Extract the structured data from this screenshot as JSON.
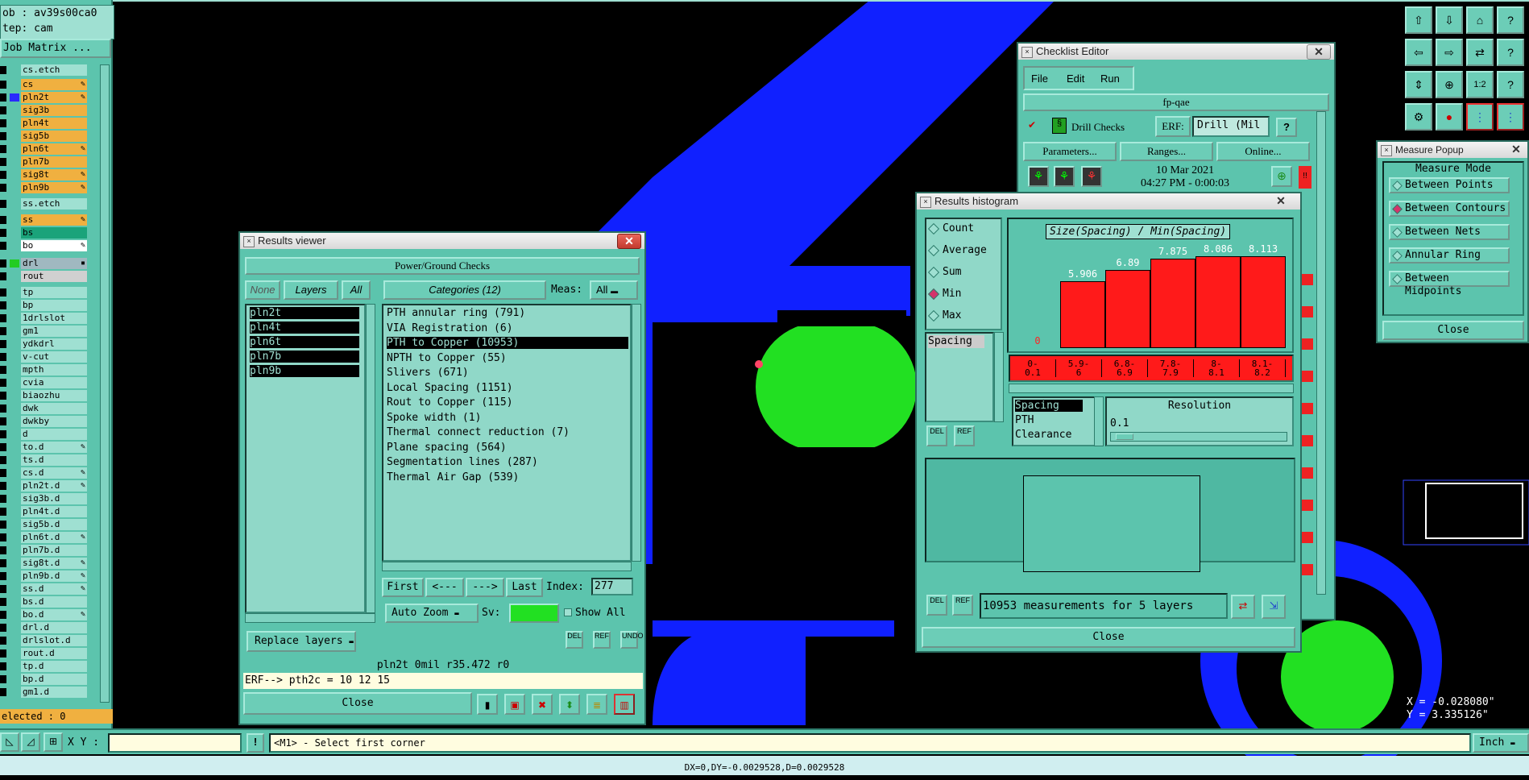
{
  "left_panel": {
    "job": "ob : av39s00ca0",
    "step": "tep: cam",
    "job_matrix_button": "Job Matrix ...",
    "layers": [
      {
        "name": "cs.etch",
        "color": "#9fe0d2",
        "swatch": "#5cc4ad",
        "mark": ""
      },
      {
        "name": "cs",
        "color": "#f0b040",
        "swatch": "#5cc4ad",
        "mark": "✎"
      },
      {
        "name": "pln2t",
        "color": "#f0b040",
        "swatch": "#2a2aff",
        "mark": "✎"
      },
      {
        "name": "sig3b",
        "color": "#f0b040",
        "swatch": "#5cc4ad",
        "mark": ""
      },
      {
        "name": "pln4t",
        "color": "#f0b040",
        "swatch": "#5cc4ad",
        "mark": ""
      },
      {
        "name": "sig5b",
        "color": "#f0b040",
        "swatch": "#5cc4ad",
        "mark": ""
      },
      {
        "name": "pln6t",
        "color": "#f0b040",
        "swatch": "#5cc4ad",
        "mark": "✎"
      },
      {
        "name": "pln7b",
        "color": "#f0b040",
        "swatch": "#5cc4ad",
        "mark": ""
      },
      {
        "name": "sig8t",
        "color": "#f0b040",
        "swatch": "#5cc4ad",
        "mark": "✎"
      },
      {
        "name": "pln9b",
        "color": "#f0b040",
        "swatch": "#5cc4ad",
        "mark": "✎"
      },
      {
        "name": "ss.etch",
        "color": "#9fe0d2",
        "swatch": "#5cc4ad",
        "mark": ""
      },
      {
        "name": "ss",
        "color": "#f0b040",
        "swatch": "#5cc4ad",
        "mark": "✎"
      },
      {
        "name": "bs",
        "color": "#1aa37a",
        "swatch": "#5cc4ad",
        "mark": ""
      },
      {
        "name": "bo",
        "color": "#ffffff",
        "swatch": "#5cc4ad",
        "mark": "✎"
      },
      {
        "name": "drl",
        "color": "#a0b8c0",
        "swatch": "#22cc22",
        "mark": "▪"
      },
      {
        "name": "rout",
        "color": "#d0d0d0",
        "swatch": "#5cc4ad",
        "mark": ""
      },
      {
        "name": "tp",
        "color": "#9fe0d2",
        "swatch": "#5cc4ad",
        "mark": ""
      },
      {
        "name": "bp",
        "color": "#9fe0d2",
        "swatch": "#5cc4ad",
        "mark": ""
      },
      {
        "name": "1drlslot",
        "color": "#9fe0d2",
        "swatch": "#5cc4ad",
        "mark": ""
      },
      {
        "name": "gm1",
        "color": "#9fe0d2",
        "swatch": "#5cc4ad",
        "mark": ""
      },
      {
        "name": "ydkdrl",
        "color": "#9fe0d2",
        "swatch": "#5cc4ad",
        "mark": ""
      },
      {
        "name": "v-cut",
        "color": "#9fe0d2",
        "swatch": "#5cc4ad",
        "mark": ""
      },
      {
        "name": "mpth",
        "color": "#9fe0d2",
        "swatch": "#5cc4ad",
        "mark": ""
      },
      {
        "name": "cvia",
        "color": "#9fe0d2",
        "swatch": "#5cc4ad",
        "mark": ""
      },
      {
        "name": "biaozhu",
        "color": "#9fe0d2",
        "swatch": "#5cc4ad",
        "mark": ""
      },
      {
        "name": "dwk",
        "color": "#9fe0d2",
        "swatch": "#5cc4ad",
        "mark": ""
      },
      {
        "name": "dwkby",
        "color": "#9fe0d2",
        "swatch": "#5cc4ad",
        "mark": ""
      },
      {
        "name": "d",
        "color": "#9fe0d2",
        "swatch": "#5cc4ad",
        "mark": ""
      },
      {
        "name": "to.d",
        "color": "#9fe0d2",
        "swatch": "#5cc4ad",
        "mark": "✎"
      },
      {
        "name": "ts.d",
        "color": "#9fe0d2",
        "swatch": "#5cc4ad",
        "mark": ""
      },
      {
        "name": "cs.d",
        "color": "#9fe0d2",
        "swatch": "#5cc4ad",
        "mark": "✎"
      },
      {
        "name": "pln2t.d",
        "color": "#9fe0d2",
        "swatch": "#5cc4ad",
        "mark": "✎"
      },
      {
        "name": "sig3b.d",
        "color": "#9fe0d2",
        "swatch": "#5cc4ad",
        "mark": ""
      },
      {
        "name": "pln4t.d",
        "color": "#9fe0d2",
        "swatch": "#5cc4ad",
        "mark": ""
      },
      {
        "name": "sig5b.d",
        "color": "#9fe0d2",
        "swatch": "#5cc4ad",
        "mark": ""
      },
      {
        "name": "pln6t.d",
        "color": "#9fe0d2",
        "swatch": "#5cc4ad",
        "mark": "✎"
      },
      {
        "name": "pln7b.d",
        "color": "#9fe0d2",
        "swatch": "#5cc4ad",
        "mark": ""
      },
      {
        "name": "sig8t.d",
        "color": "#9fe0d2",
        "swatch": "#5cc4ad",
        "mark": "✎"
      },
      {
        "name": "pln9b.d",
        "color": "#9fe0d2",
        "swatch": "#5cc4ad",
        "mark": "✎"
      },
      {
        "name": "ss.d",
        "color": "#9fe0d2",
        "swatch": "#5cc4ad",
        "mark": "✎"
      },
      {
        "name": "bs.d",
        "color": "#9fe0d2",
        "swatch": "#5cc4ad",
        "mark": ""
      },
      {
        "name": "bo.d",
        "color": "#9fe0d2",
        "swatch": "#5cc4ad",
        "mark": "✎"
      },
      {
        "name": "drl.d",
        "color": "#9fe0d2",
        "swatch": "#5cc4ad",
        "mark": ""
      },
      {
        "name": "drlslot.d",
        "color": "#9fe0d2",
        "swatch": "#5cc4ad",
        "mark": ""
      },
      {
        "name": "rout.d",
        "color": "#9fe0d2",
        "swatch": "#5cc4ad",
        "mark": ""
      },
      {
        "name": "tp.d",
        "color": "#9fe0d2",
        "swatch": "#5cc4ad",
        "mark": ""
      },
      {
        "name": "bp.d",
        "color": "#9fe0d2",
        "swatch": "#5cc4ad",
        "mark": ""
      },
      {
        "name": "gm1.d",
        "color": "#9fe0d2",
        "swatch": "#5cc4ad",
        "mark": ""
      }
    ],
    "selected_label": "elected : 0"
  },
  "results_viewer": {
    "title": "Results viewer",
    "header": "Power/Ground Checks",
    "none_label": "None",
    "layers_label": "Layers",
    "all_label": "All",
    "categories_label": "Categories (12)",
    "meas_label": "Meas:",
    "meas_value": "All",
    "layers": [
      "pln2t",
      "pln4t",
      "pln6t",
      "pln7b",
      "pln9b"
    ],
    "categories": [
      {
        "text": "PTH annular ring (791)",
        "selected": false
      },
      {
        "text": "VIA Registration (6)",
        "selected": false
      },
      {
        "text": "PTH to Copper (10953)",
        "selected": true
      },
      {
        "text": "NPTH to Copper (55)",
        "selected": false
      },
      {
        "text": "Slivers (671)",
        "selected": false
      },
      {
        "text": "Local Spacing (1151)",
        "selected": false
      },
      {
        "text": "Rout to Copper (115)",
        "selected": false
      },
      {
        "text": "Spoke width (1)",
        "selected": false
      },
      {
        "text": "Thermal connect reduction (7)",
        "selected": false
      },
      {
        "text": "Plane spacing (564)",
        "selected": false
      },
      {
        "text": "Segmentation lines (287)",
        "selected": false
      },
      {
        "text": "Thermal Air Gap (539)",
        "selected": false
      }
    ],
    "first": "First",
    "prev": "<---",
    "next": "--->",
    "last": "Last",
    "index_label": "Index:",
    "index_value": "277",
    "auto_zoom": "Auto Zoom",
    "sv_label": "Sv:",
    "show_all": "Show All",
    "replace_layers": "Replace layers",
    "del": "DEL",
    "ref": "REF",
    "undo": "UNDO",
    "status_line": "pln2t 0mil  r35.472  r0",
    "erf_line": "ERF--> pth2c = 10 12 15",
    "close": "Close"
  },
  "checklist_editor": {
    "title": "Checklist Editor",
    "menu": [
      "File",
      "Edit",
      "Run"
    ],
    "name": "fp-qae",
    "check_name": "Drill Checks",
    "erf_label": "ERF:",
    "erf_value": "Drill (Mil",
    "help": "?",
    "parameters": "Parameters...",
    "ranges": "Ranges...",
    "online": "Online...",
    "date": "10 Mar 2021",
    "time": "04:27 PM - 0:00:03"
  },
  "histogram": {
    "title": "Results histogram",
    "modes": [
      {
        "label": "Count",
        "on": false
      },
      {
        "label": "Average",
        "on": false
      },
      {
        "label": "Sum",
        "on": false
      },
      {
        "label": "Min",
        "on": true
      },
      {
        "label": "Max",
        "on": false
      }
    ],
    "measure_list": [
      "Spacing"
    ],
    "chart_title": "Size(Spacing) / Min(Spacing)",
    "type_list": [
      "Spacing",
      "PTH",
      "Clearance"
    ],
    "resolution_label": "Resolution",
    "resolution_value": "0.1",
    "summary": "10953 measurements for 5 layers",
    "close": "Close",
    "del": "DEL",
    "ref": "REF"
  },
  "chart_data": {
    "type": "bar",
    "title": "Size(Spacing) / Min(Spacing)",
    "categories": [
      "0-\n0.1",
      "5.9-\n6",
      "6.8-\n6.9",
      "7.8-\n7.9",
      "8-\n8.1",
      "8.1-\n8.2"
    ],
    "value_labels": [
      "0",
      "5.906",
      "6.89",
      "7.875",
      "8.086",
      "8.113"
    ],
    "values": [
      0,
      5.906,
      6.89,
      7.875,
      8.086,
      8.113
    ],
    "ylim": [
      0,
      10
    ]
  },
  "measure_popup": {
    "title": "Measure Popup",
    "mode_label": "Measure Mode",
    "modes": [
      {
        "label": "Between Points",
        "on": false
      },
      {
        "label": "Between Contours",
        "on": true
      },
      {
        "label": "Between Nets",
        "on": false
      },
      {
        "label": "Annular Ring",
        "on": false
      },
      {
        "label": "Between Midpoints",
        "on": false
      }
    ],
    "close": "Close"
  },
  "coords": {
    "x": "X = -0.028080\"",
    "y": "Y = 3.335126\""
  },
  "bottom": {
    "xy_label": "X Y :",
    "xy_value": "",
    "prompt": "<M1> - Select first corner",
    "units": "Inch",
    "status": "DX=0,DY=-0.0029528,D=0.0029528"
  },
  "colors": {
    "panel": "#5cc4ad",
    "copper": "#1020ff",
    "pad": "#22e022",
    "bar": "#ff1a1a"
  }
}
